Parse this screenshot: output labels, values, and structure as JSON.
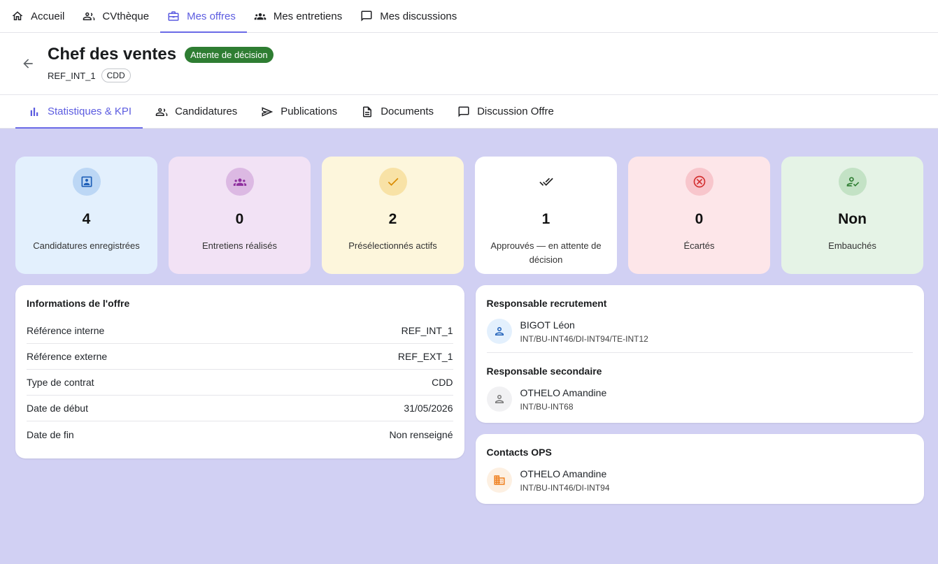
{
  "topnav": [
    {
      "label": "Accueil",
      "icon": "home-icon",
      "active": false
    },
    {
      "label": "CVthèque",
      "icon": "people-icon",
      "active": false
    },
    {
      "label": "Mes offres",
      "icon": "briefcase-icon",
      "active": true
    },
    {
      "label": "Mes entretiens",
      "icon": "groups-icon",
      "active": false
    },
    {
      "label": "Mes discussions",
      "icon": "chat-icon",
      "active": false
    }
  ],
  "header": {
    "title": "Chef des ventes",
    "status": "Attente de décision",
    "status_color": "#2e7d32",
    "reference": "REF_INT_1",
    "contract_chip": "CDD"
  },
  "subtabs": [
    {
      "label": "Statistiques & KPI",
      "icon": "bar-chart-icon",
      "active": true
    },
    {
      "label": "Candidatures",
      "icon": "people-icon",
      "active": false
    },
    {
      "label": "Publications",
      "icon": "send-icon",
      "active": false
    },
    {
      "label": "Documents",
      "icon": "document-icon",
      "active": false
    },
    {
      "label": "Discussion Offre",
      "icon": "chat-icon",
      "active": false
    }
  ],
  "kpis": [
    {
      "value": "4",
      "label": "Candidatures enregistrées",
      "bg": "#e3f0fd",
      "icon_bg": "#bcd7f5",
      "icon_color": "#1e5fb8",
      "icon": "contact-card-icon"
    },
    {
      "value": "0",
      "label": "Entretiens réalisés",
      "bg": "#f2e2f5",
      "icon_bg": "#dcb9e3",
      "icon_color": "#8e2f9e",
      "icon": "groups-icon"
    },
    {
      "value": "2",
      "label": "Présélectionnés actifs",
      "bg": "#fdf6dc",
      "icon_bg": "#f8e2a6",
      "icon_color": "#d98a00",
      "icon": "check-icon"
    },
    {
      "value": "1",
      "label": "Approuvés — en attente de décision",
      "bg": "#ffffff",
      "icon_bg": "#ffffff",
      "icon_color": "#222222",
      "icon": "double-check-icon"
    },
    {
      "value": "0",
      "label": "Écartés",
      "bg": "#fde6e9",
      "icon_bg": "#f8c6cc",
      "icon_color": "#d32f2f",
      "icon": "cancel-icon"
    },
    {
      "value": "Non",
      "label": "Embauchés",
      "bg": "#e5f3e6",
      "icon_bg": "#c3e2c5",
      "icon_color": "#2e7d32",
      "icon": "person-check-icon"
    }
  ],
  "offer_info": {
    "title": "Informations de l'offre",
    "rows": [
      {
        "label": "Référence interne",
        "value": "REF_INT_1"
      },
      {
        "label": "Référence externe",
        "value": "REF_EXT_1"
      },
      {
        "label": "Type de contrat",
        "value": "CDD"
      },
      {
        "label": "Date de début",
        "value": "31/05/2026"
      },
      {
        "label": "Date de fin",
        "value": "Non renseigné"
      }
    ]
  },
  "recruiters": {
    "primary_title": "Responsable recrutement",
    "primary": {
      "name": "BIGOT Léon",
      "org": "INT/BU-INT46/DI-INT94/TE-INT12",
      "avatar_bg": "#e3f0fd",
      "avatar_color": "#1e5fb8"
    },
    "secondary_title": "Responsable secondaire",
    "secondary": {
      "name": "OTHELO Amandine",
      "org": "INT/BU-INT68",
      "avatar_bg": "#f1f1f3",
      "avatar_color": "#777777"
    }
  },
  "ops": {
    "title": "Contacts OPS",
    "contact": {
      "name": "OTHELO Amandine",
      "org": "INT/BU-INT46/DI-INT94",
      "avatar_bg": "#fdf0e2",
      "avatar_color": "#ef7d1a"
    }
  }
}
